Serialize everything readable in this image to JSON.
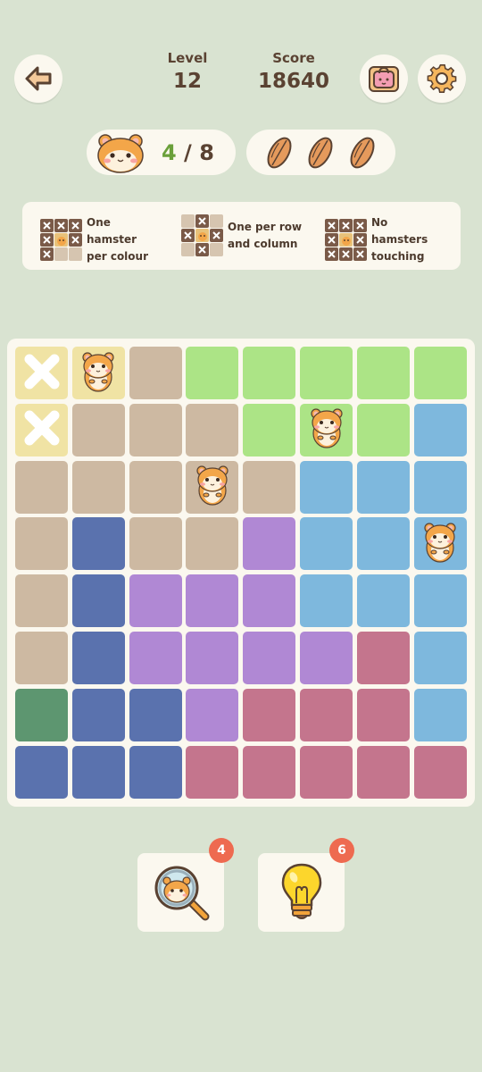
{
  "header": {
    "level_label": "Level",
    "level_value": "12",
    "score_label": "Score",
    "score_value": "18640",
    "back_icon": "back-arrow-icon",
    "shop_icon": "shop-bag-icon",
    "settings_icon": "gear-icon"
  },
  "progress": {
    "found": "4",
    "separator": " / ",
    "total": "8",
    "seeds_remaining": 3,
    "seed_icon": "sunflower-seed-icon"
  },
  "rules": [
    {
      "line1": "One hamster",
      "line2": "per colour"
    },
    {
      "line1": "One per row",
      "line2": "and column"
    },
    {
      "line1": "No hamsters",
      "line2": "touching"
    }
  ],
  "board": {
    "size": 8,
    "colors": {
      "tan": "#cdb9a2",
      "green": "#ace486",
      "lightblue": "#7eb8dd",
      "navy": "#5a72ae",
      "purple": "#b088d4",
      "rose": "#c4758d",
      "darkgreen": "#5d9670",
      "yellow": "#f0e3a4"
    },
    "regions": [
      [
        "tan",
        "tan",
        "tan",
        "green",
        "green",
        "green",
        "green",
        "green"
      ],
      [
        "tan",
        "tan",
        "tan",
        "tan",
        "green",
        "green",
        "green",
        "lightblue"
      ],
      [
        "tan",
        "tan",
        "tan",
        "tan",
        "tan",
        "lightblue",
        "lightblue",
        "lightblue"
      ],
      [
        "tan",
        "navy",
        "tan",
        "tan",
        "purple",
        "lightblue",
        "lightblue",
        "lightblue"
      ],
      [
        "tan",
        "navy",
        "purple",
        "purple",
        "purple",
        "lightblue",
        "lightblue",
        "lightblue"
      ],
      [
        "tan",
        "navy",
        "purple",
        "purple",
        "purple",
        "purple",
        "rose",
        "lightblue"
      ],
      [
        "darkgreen",
        "navy",
        "navy",
        "purple",
        "rose",
        "rose",
        "rose",
        "lightblue"
      ],
      [
        "navy",
        "navy",
        "navy",
        "rose",
        "rose",
        "rose",
        "rose",
        "rose"
      ]
    ],
    "marks": [
      {
        "row": 0,
        "col": 0,
        "type": "x"
      },
      {
        "row": 1,
        "col": 0,
        "type": "x"
      }
    ],
    "hamsters": [
      {
        "row": 0,
        "col": 1
      },
      {
        "row": 1,
        "col": 5
      },
      {
        "row": 2,
        "col": 3
      },
      {
        "row": 3,
        "col": 7
      }
    ]
  },
  "powerups": [
    {
      "name": "magnifier",
      "icon": "hamster-magnifier-icon",
      "count": "4"
    },
    {
      "name": "hint",
      "icon": "lightbulb-icon",
      "count": "6"
    }
  ]
}
